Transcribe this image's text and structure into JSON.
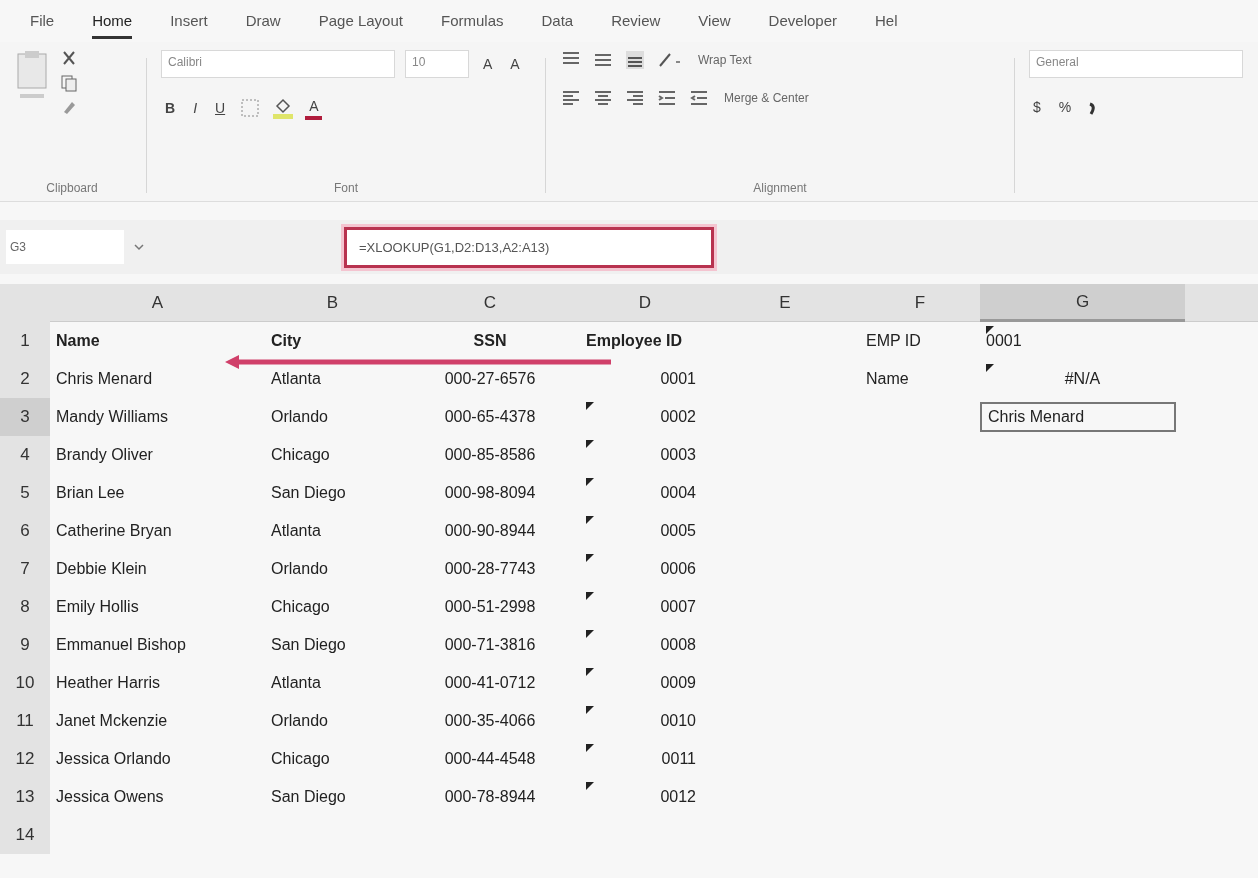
{
  "ribbon_tabs": [
    {
      "label": "File",
      "selected": false
    },
    {
      "label": "Home",
      "selected": true
    },
    {
      "label": "Insert",
      "selected": false
    },
    {
      "label": "Draw",
      "selected": false
    },
    {
      "label": "Page Layout",
      "selected": false
    },
    {
      "label": "Formulas",
      "selected": false
    },
    {
      "label": "Data",
      "selected": false
    },
    {
      "label": "Review",
      "selected": false
    },
    {
      "label": "View",
      "selected": false
    },
    {
      "label": "Developer",
      "selected": false
    },
    {
      "label": "Hel",
      "selected": false
    }
  ],
  "ribbon": {
    "clipboard": {
      "label": "Clipboard"
    },
    "font": {
      "label": "Font",
      "font_name": "Calibri",
      "font_size": "10",
      "grow": "A",
      "shrink": "A",
      "bold": "B",
      "italic": "I",
      "underline": "U",
      "font_color": "A"
    },
    "alignment": {
      "label": "Alignment",
      "wrap_text": "Wrap Text",
      "merge_center": "Merge & Center"
    },
    "number": {
      "format": "General",
      "currency": "$",
      "percent": "%"
    }
  },
  "formula_bar": {
    "name_box": "G3",
    "formula": "=XLOOKUP(G1,D2:D13,A2:A13)",
    "highlighted": true
  },
  "sheet": {
    "columns": [
      {
        "label": "A",
        "selected": false
      },
      {
        "label": "B",
        "selected": false
      },
      {
        "label": "C",
        "selected": false
      },
      {
        "label": "D",
        "selected": false
      },
      {
        "label": "E",
        "selected": false
      },
      {
        "label": "F",
        "selected": false
      },
      {
        "label": "G",
        "selected": true
      }
    ],
    "rows": [
      {
        "number": "1",
        "selected": false,
        "cells": [
          {
            "text": "Name",
            "kind": "label",
            "flag": false,
            "selected": false
          },
          {
            "text": "City",
            "kind": "label",
            "flag": false,
            "selected": false
          },
          {
            "text": "SSN",
            "kind": "label",
            "flag": false,
            "selected": false
          },
          {
            "text": "Employee ID",
            "kind": "label",
            "flag": false,
            "selected": false
          },
          {
            "kind": "empty"
          },
          {
            "text": "EMP ID",
            "kind": "text",
            "flag": false,
            "selected": false
          },
          {
            "text": "0001",
            "kind": "text",
            "flag": true,
            "selected": false
          }
        ]
      },
      {
        "number": "2",
        "selected": false,
        "cells": [
          {
            "text": "Chris Menard",
            "kind": "text",
            "flag": false,
            "selected": false
          },
          {
            "text": "Atlanta",
            "kind": "text",
            "flag": false,
            "selected": false
          },
          {
            "text": "000-27-6576",
            "kind": "text",
            "flag": false,
            "selected": false
          },
          {
            "text": "0001",
            "kind": "number",
            "flag": false,
            "selected": false
          },
          {
            "kind": "empty"
          },
          {
            "text": "Name",
            "kind": "text",
            "flag": false,
            "selected": false
          },
          {
            "text": "#N/A",
            "kind": "error",
            "flag": true,
            "selected": false
          }
        ]
      },
      {
        "number": "3",
        "selected": true,
        "cells": [
          {
            "text": "Mandy Williams",
            "kind": "text",
            "flag": false,
            "selected": false
          },
          {
            "text": "Orlando",
            "kind": "text",
            "flag": false,
            "selected": false
          },
          {
            "text": "000-65-4378",
            "kind": "text",
            "flag": false,
            "selected": false
          },
          {
            "text": "0002",
            "kind": "number",
            "flag": true,
            "selected": false
          },
          {
            "kind": "empty"
          },
          {
            "kind": "empty"
          },
          {
            "text": "Chris Menard",
            "kind": "text",
            "flag": false,
            "selected": true
          }
        ]
      },
      {
        "number": "4",
        "selected": false,
        "cells": [
          {
            "text": "Brandy Oliver",
            "kind": "text",
            "flag": false,
            "selected": false
          },
          {
            "text": "Chicago",
            "kind": "text",
            "flag": false,
            "selected": false
          },
          {
            "text": "000-85-8586",
            "kind": "text",
            "flag": false,
            "selected": false
          },
          {
            "text": "0003",
            "kind": "number",
            "flag": true,
            "selected": false
          },
          {
            "kind": "empty"
          },
          {
            "kind": "empty"
          },
          {
            "kind": "empty"
          }
        ]
      },
      {
        "number": "5",
        "selected": false,
        "cells": [
          {
            "text": "Brian Lee",
            "kind": "text",
            "flag": false,
            "selected": false
          },
          {
            "text": "San Diego",
            "kind": "text",
            "flag": false,
            "selected": false
          },
          {
            "text": "000-98-8094",
            "kind": "text",
            "flag": false,
            "selected": false
          },
          {
            "text": "0004",
            "kind": "number",
            "flag": true,
            "selected": false
          },
          {
            "kind": "empty"
          },
          {
            "kind": "empty"
          },
          {
            "kind": "empty"
          }
        ]
      },
      {
        "number": "6",
        "selected": false,
        "cells": [
          {
            "text": "Catherine Bryan",
            "kind": "text",
            "flag": false,
            "selected": false
          },
          {
            "text": "Atlanta",
            "kind": "text",
            "flag": false,
            "selected": false
          },
          {
            "text": "000-90-8944",
            "kind": "text",
            "flag": false,
            "selected": false
          },
          {
            "text": "0005",
            "kind": "number",
            "flag": true,
            "selected": false
          },
          {
            "kind": "empty"
          },
          {
            "kind": "empty"
          },
          {
            "kind": "empty"
          }
        ]
      },
      {
        "number": "7",
        "selected": false,
        "cells": [
          {
            "text": "Debbie Klein",
            "kind": "text",
            "flag": false,
            "selected": false
          },
          {
            "text": "Orlando",
            "kind": "text",
            "flag": false,
            "selected": false
          },
          {
            "text": "000-28-7743",
            "kind": "text",
            "flag": false,
            "selected": false
          },
          {
            "text": "0006",
            "kind": "number",
            "flag": true,
            "selected": false
          },
          {
            "kind": "empty"
          },
          {
            "kind": "empty"
          },
          {
            "kind": "empty"
          }
        ]
      },
      {
        "number": "8",
        "selected": false,
        "cells": [
          {
            "text": "Emily Hollis",
            "kind": "text",
            "flag": false,
            "selected": false
          },
          {
            "text": "Chicago",
            "kind": "text",
            "flag": false,
            "selected": false
          },
          {
            "text": "000-51-2998",
            "kind": "text",
            "flag": false,
            "selected": false
          },
          {
            "text": "0007",
            "kind": "number",
            "flag": true,
            "selected": false
          },
          {
            "kind": "empty"
          },
          {
            "kind": "empty"
          },
          {
            "kind": "empty"
          }
        ]
      },
      {
        "number": "9",
        "selected": false,
        "cells": [
          {
            "text": "Emmanuel Bishop",
            "kind": "text",
            "flag": false,
            "selected": false
          },
          {
            "text": "San Diego",
            "kind": "text",
            "flag": false,
            "selected": false
          },
          {
            "text": "000-71-3816",
            "kind": "text",
            "flag": false,
            "selected": false
          },
          {
            "text": "0008",
            "kind": "number",
            "flag": true,
            "selected": false
          },
          {
            "kind": "empty"
          },
          {
            "kind": "empty"
          },
          {
            "kind": "empty"
          }
        ]
      },
      {
        "number": "10",
        "selected": false,
        "cells": [
          {
            "text": "Heather Harris",
            "kind": "text",
            "flag": false,
            "selected": false
          },
          {
            "text": "Atlanta",
            "kind": "text",
            "flag": false,
            "selected": false
          },
          {
            "text": "000-41-0712",
            "kind": "text",
            "flag": false,
            "selected": false
          },
          {
            "text": "0009",
            "kind": "number",
            "flag": true,
            "selected": false
          },
          {
            "kind": "empty"
          },
          {
            "kind": "empty"
          },
          {
            "kind": "empty"
          }
        ]
      },
      {
        "number": "11",
        "selected": false,
        "cells": [
          {
            "text": "Janet Mckenzie",
            "kind": "text",
            "flag": false,
            "selected": false
          },
          {
            "text": "Orlando",
            "kind": "text",
            "flag": false,
            "selected": false
          },
          {
            "text": "000-35-4066",
            "kind": "text",
            "flag": false,
            "selected": false
          },
          {
            "text": "0010",
            "kind": "number",
            "flag": true,
            "selected": false
          },
          {
            "kind": "empty"
          },
          {
            "kind": "empty"
          },
          {
            "kind": "empty"
          }
        ]
      },
      {
        "number": "12",
        "selected": false,
        "cells": [
          {
            "text": "Jessica Orlando",
            "kind": "text",
            "flag": false,
            "selected": false
          },
          {
            "text": "Chicago",
            "kind": "text",
            "flag": false,
            "selected": false
          },
          {
            "text": "000-44-4548",
            "kind": "text",
            "flag": false,
            "selected": false
          },
          {
            "text": "0011",
            "kind": "number",
            "flag": true,
            "selected": false
          },
          {
            "kind": "empty"
          },
          {
            "kind": "empty"
          },
          {
            "kind": "empty"
          }
        ]
      },
      {
        "number": "13",
        "selected": false,
        "cells": [
          {
            "text": "Jessica Owens",
            "kind": "text",
            "flag": false,
            "selected": false
          },
          {
            "text": "San Diego",
            "kind": "text",
            "flag": false,
            "selected": false
          },
          {
            "text": "000-78-8944",
            "kind": "text",
            "flag": false,
            "selected": false
          },
          {
            "text": "0012",
            "kind": "number",
            "flag": true,
            "selected": false
          },
          {
            "kind": "empty"
          },
          {
            "kind": "empty"
          },
          {
            "kind": "empty"
          }
        ]
      },
      {
        "number": "14",
        "selected": false,
        "cells": [
          {
            "kind": "empty"
          },
          {
            "kind": "empty"
          },
          {
            "kind": "empty"
          },
          {
            "kind": "empty"
          },
          {
            "kind": "empty"
          },
          {
            "kind": "empty"
          },
          {
            "kind": "empty"
          }
        ]
      }
    ]
  }
}
